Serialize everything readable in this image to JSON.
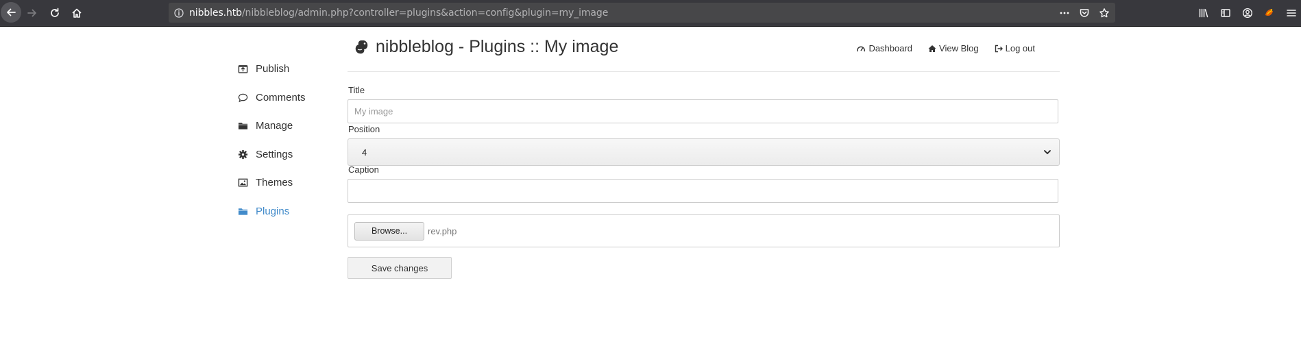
{
  "browser": {
    "url_host": "nibbles.htb",
    "url_path": "/nibbleblog/admin.php?controller=plugins&action=config&plugin=my_image",
    "icons": [
      "back-icon",
      "forward-icon",
      "reload-icon",
      "home-icon",
      "site-info-icon",
      "page-actions-icon",
      "pocket-icon",
      "bookmark-star-icon",
      "library-icon",
      "sidebar-icon",
      "account-icon",
      "extension-icon",
      "menu-icon"
    ]
  },
  "sidebar": {
    "items": [
      {
        "label": "Publish",
        "icon": "publish-icon"
      },
      {
        "label": "Comments",
        "icon": "comment-icon"
      },
      {
        "label": "Manage",
        "icon": "folder-icon"
      },
      {
        "label": "Settings",
        "icon": "gear-icon"
      },
      {
        "label": "Themes",
        "icon": "image-icon"
      },
      {
        "label": "Plugins",
        "icon": "folder-icon",
        "active": true
      }
    ],
    "active_color": "#428bca"
  },
  "header": {
    "title": "nibbleblog - Plugins :: My image",
    "nav": [
      {
        "label": "Dashboard",
        "icon": "dashboard-icon"
      },
      {
        "label": "View Blog",
        "icon": "home-icon"
      },
      {
        "label": "Log out",
        "icon": "logout-icon"
      }
    ]
  },
  "form": {
    "title_label": "Title",
    "title_placeholder": "My image",
    "title_value": "",
    "position_label": "Position",
    "position_value": "4",
    "caption_label": "Caption",
    "caption_value": "",
    "browse_label": "Browse...",
    "file_name": "rev.php",
    "save_label": "Save changes"
  }
}
